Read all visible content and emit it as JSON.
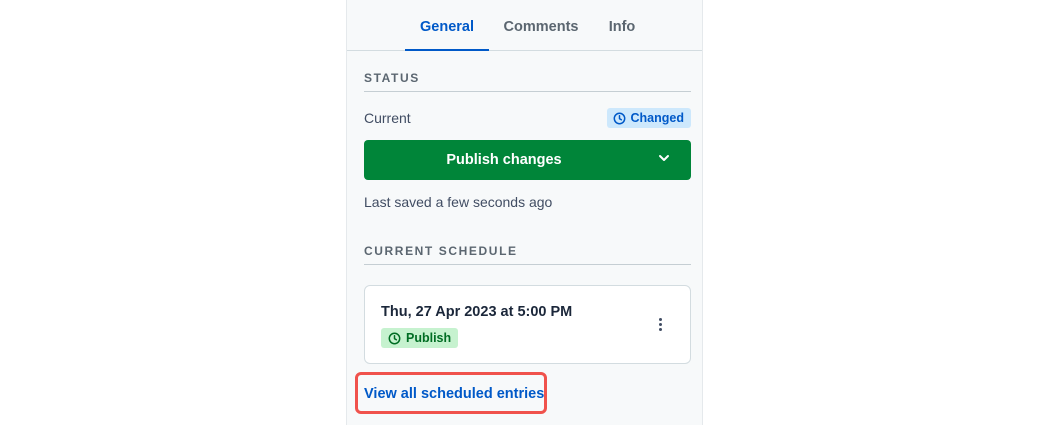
{
  "tabs": [
    {
      "label": "General",
      "active": true
    },
    {
      "label": "Comments",
      "active": false
    },
    {
      "label": "Info",
      "active": false
    }
  ],
  "status": {
    "section_title": "STATUS",
    "current_label": "Current",
    "badge_label": "Changed",
    "badge_icon": "clock-icon",
    "publish_button_label": "Publish changes",
    "publish_caret_icon": "chevron-down-icon",
    "last_saved": "Last saved a few seconds ago"
  },
  "schedule": {
    "section_title": "CURRENT SCHEDULE",
    "entry_date": "Thu, 27 Apr 2023 at 5:00 PM",
    "entry_action": "Publish",
    "entry_action_icon": "clock-icon",
    "menu_icon": "kebab-menu-icon",
    "view_all_label": "View all scheduled entries"
  },
  "colors": {
    "accent": "#0059c8",
    "publish_green": "#008539",
    "highlight_red": "#f0524c",
    "changed_badge_bg": "#cde8fc",
    "publish_badge_bg": "#c6f2cf"
  }
}
